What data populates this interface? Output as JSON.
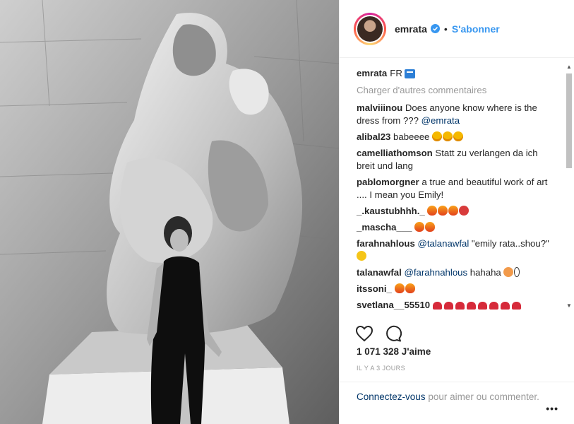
{
  "post": {
    "username": "emrata",
    "dot": "•",
    "follow_label": "S'abonner",
    "caption_username": "emrata",
    "caption_text": "FR",
    "load_more": "Charger d'autres commentaires",
    "likes": "1 071 328 J'aime",
    "timestamp": "IL Y A 3 JOURS",
    "login_link": "Connectez-vous",
    "login_rest": " pour aimer ou commenter.",
    "more_label": "•••"
  },
  "comments": [
    {
      "user": "malviiinou",
      "text": " Does anyone know where is the dress from ??? ",
      "mention": "@emrata",
      "after": "",
      "emojis": []
    },
    {
      "user": "alibal23",
      "text": " babeeee ",
      "mention": "",
      "after": "",
      "emojis": [
        "heart-eyes",
        "heart-eyes",
        "heart-eyes"
      ]
    },
    {
      "user": "camelliathomson",
      "text": " Statt zu verlangen da ich breit und lang",
      "mention": "",
      "after": "",
      "emojis": []
    },
    {
      "user": "pablomorgner",
      "text": " a true and beautiful work of art .... I mean you Emily!",
      "mention": "",
      "after": "",
      "emojis": []
    },
    {
      "user": "_.kaustubhhh._",
      "text": " ",
      "mention": "",
      "after": "",
      "emojis": [
        "fire",
        "fire",
        "fire",
        "tongue"
      ]
    },
    {
      "user": "_mascha___",
      "text": " ",
      "mention": "",
      "after": "",
      "emojis": [
        "fire",
        "fire"
      ]
    },
    {
      "user": "farahnahlous",
      "text": " ",
      "mention": "@talanawfal",
      "after": " \"emily rata..shou?\"",
      "emojis": [
        "laugh"
      ]
    },
    {
      "user": "talanawfal",
      "text": " ",
      "mention": "@farahnahlous",
      "after": " hahaha ",
      "emojis": [
        "peach",
        "eyes"
      ]
    },
    {
      "user": "itssoni_",
      "text": " ",
      "mention": "",
      "after": "",
      "emojis": [
        "fire",
        "fire"
      ]
    },
    {
      "user": "svetlana__55510",
      "text": " ",
      "mention": "",
      "after": "",
      "emojis": [
        "heart",
        "heart",
        "heart",
        "heart",
        "heart",
        "heart",
        "heart",
        "heart"
      ]
    }
  ],
  "icons": {
    "verified": "verified-badge-icon",
    "like": "heart-outline-icon",
    "comment": "comment-bubble-icon",
    "more": "ellipsis-icon",
    "scroll_up": "▲",
    "scroll_down": "▼"
  },
  "colors": {
    "link_blue": "#3897f0",
    "mention": "#003569",
    "muted": "#999999",
    "text": "#262626"
  }
}
